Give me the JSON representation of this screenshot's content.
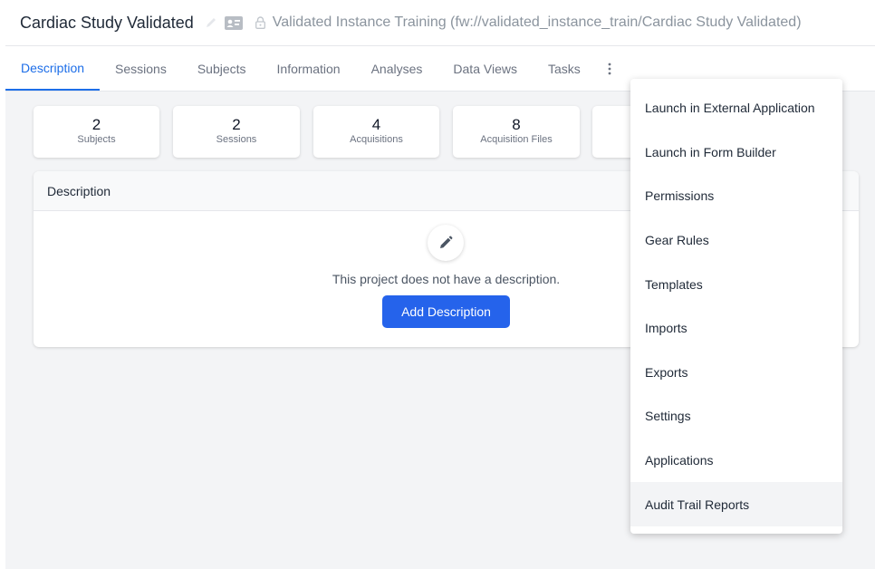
{
  "header": {
    "title": "Cardiac Study Validated",
    "breadcrumb": "Validated Instance Training (fw://validated_instance_train/Cardiac Study Validated)"
  },
  "tabs": [
    {
      "label": "Description",
      "active": true
    },
    {
      "label": "Sessions"
    },
    {
      "label": "Subjects"
    },
    {
      "label": "Information"
    },
    {
      "label": "Analyses"
    },
    {
      "label": "Data Views"
    },
    {
      "label": "Tasks"
    }
  ],
  "stats": [
    {
      "value": "2",
      "label": "Subjects"
    },
    {
      "value": "2",
      "label": "Sessions"
    },
    {
      "value": "4",
      "label": "Acquisitions"
    },
    {
      "value": "8",
      "label": "Acquisition Files"
    }
  ],
  "description": {
    "heading": "Description",
    "empty_message": "This project does not have a description.",
    "add_button": "Add Description"
  },
  "menu": {
    "items": [
      "Launch in External Application",
      "Launch in Form Builder",
      "Permissions",
      "Gear Rules",
      "Templates",
      "Imports",
      "Exports",
      "Settings",
      "Applications",
      "Audit Trail Reports"
    ],
    "hovered": "Audit Trail Reports"
  },
  "icons": {
    "title_edit": "pencil-icon",
    "title_card": "id-card-icon",
    "title_lock": "lock-icon",
    "tab_more": "vertical-ellipsis-icon",
    "description_edit": "pencil-icon"
  },
  "colors": {
    "accent": "#1d6ee8",
    "button": "#2563eb",
    "background": "#f3f4f6"
  }
}
